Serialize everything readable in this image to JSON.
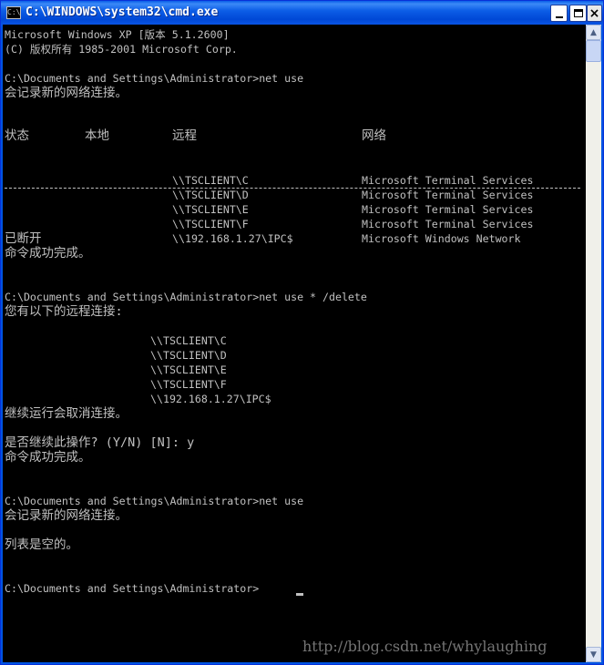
{
  "window": {
    "title": "C:\\WINDOWS\\system32\\cmd.exe",
    "icon_label": "C:\\",
    "buttons": {
      "minimize": "minimize",
      "maximize": "maximize",
      "close": "×"
    }
  },
  "console": {
    "lines": [
      "Microsoft Windows XP [版本 5.1.2600]",
      "(C) 版权所有 1985-2001 Microsoft Corp.",
      "C:\\Documents and Settings\\Administrator>net use",
      "会记录新的网络连接。",
      "已断开",
      "命令成功完成。",
      "C:\\Documents and Settings\\Administrator>net use * /delete",
      "您有以下的远程连接:",
      "继续运行会取消连接。",
      "是否继续此操作? (Y/N) [N]: y",
      "命令成功完成。",
      "C:\\Documents and Settings\\Administrator>net use",
      "会记录新的网络连接。",
      "列表是空的。",
      "C:\\Documents and Settings\\Administrator>"
    ],
    "table_headers": [
      "状态",
      "本地",
      "远程",
      "网络"
    ],
    "connections": [
      {
        "remote": "\\\\TSCLIENT\\C",
        "network": "Microsoft Terminal Services"
      },
      {
        "remote": "\\\\TSCLIENT\\D",
        "network": "Microsoft Terminal Services"
      },
      {
        "remote": "\\\\TSCLIENT\\E",
        "network": "Microsoft Terminal Services"
      },
      {
        "remote": "\\\\TSCLIENT\\F",
        "network": "Microsoft Terminal Services"
      },
      {
        "remote": "\\\\192.168.1.27\\IPC$",
        "network": "Microsoft Windows Network"
      }
    ],
    "delete_list": [
      "\\\\TSCLIENT\\C",
      "\\\\TSCLIENT\\D",
      "\\\\TSCLIENT\\E",
      "\\\\TSCLIENT\\F",
      "\\\\192.168.1.27\\IPC$"
    ]
  },
  "watermark": "http://blog.csdn.net/whylaughing",
  "colors": {
    "titlebar": "#0054e3",
    "console_bg": "#000000",
    "console_text": "#c0c0c0"
  }
}
